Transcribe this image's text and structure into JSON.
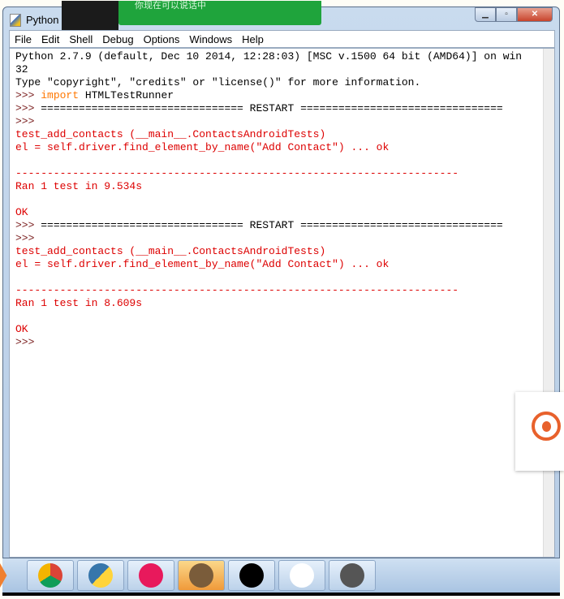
{
  "window": {
    "title": "Python",
    "overlay_text": "你现在可以说话中"
  },
  "menu": [
    "File",
    "Edit",
    "Shell",
    "Debug",
    "Options",
    "Windows",
    "Help"
  ],
  "lines": [
    [
      {
        "t": "Python 2.7.9 (default, Dec 10 2014, 12:28:03) [MSC v.1500 64 bit (AMD64)] on win",
        "c": "out"
      }
    ],
    [
      {
        "t": "32",
        "c": "out"
      }
    ],
    [
      {
        "t": "Type \"copyright\", \"credits\" or \"license()\" for more information.",
        "c": "out"
      }
    ],
    [
      {
        "t": ">>> ",
        "c": "prompt"
      },
      {
        "t": "import",
        "c": "kw"
      },
      {
        "t": " HTMLTestRunner",
        "c": "out"
      }
    ],
    [
      {
        "t": ">>> ",
        "c": "prompt"
      },
      {
        "t": "================================ RESTART ================================",
        "c": "out"
      }
    ],
    [
      {
        "t": ">>> ",
        "c": "prompt"
      }
    ],
    [
      {
        "t": "test_add_contacts (__main__.ContactsAndroidTests)",
        "c": "err"
      }
    ],
    [
      {
        "t": "el = self.driver.find_element_by_name(\"Add Contact\") ... ok",
        "c": "err"
      }
    ],
    [
      {
        "t": "",
        "c": "err"
      }
    ],
    [
      {
        "t": "----------------------------------------------------------------------",
        "c": "err"
      }
    ],
    [
      {
        "t": "Ran 1 test in 9.534s",
        "c": "err"
      }
    ],
    [
      {
        "t": "",
        "c": "err"
      }
    ],
    [
      {
        "t": "OK",
        "c": "err"
      }
    ],
    [
      {
        "t": ">>> ",
        "c": "prompt"
      },
      {
        "t": "================================ RESTART ================================",
        "c": "out"
      }
    ],
    [
      {
        "t": ">>> ",
        "c": "prompt"
      }
    ],
    [
      {
        "t": "test_add_contacts (__main__.ContactsAndroidTests)",
        "c": "err"
      }
    ],
    [
      {
        "t": "el = self.driver.find_element_by_name(\"Add Contact\") ... ok",
        "c": "err"
      }
    ],
    [
      {
        "t": "",
        "c": "err"
      }
    ],
    [
      {
        "t": "----------------------------------------------------------------------",
        "c": "err"
      }
    ],
    [
      {
        "t": "Ran 1 test in 8.609s",
        "c": "err"
      }
    ],
    [
      {
        "t": "",
        "c": "err"
      }
    ],
    [
      {
        "t": "OK",
        "c": "err"
      }
    ],
    [
      {
        "t": ">>> ",
        "c": "prompt"
      }
    ]
  ],
  "taskbar": [
    {
      "name": "chrome-icon",
      "bg": "conic-gradient(#db4437 0 33%,#0f9d58 0 66%,#f4b400 0)",
      "active": false
    },
    {
      "name": "python-file-icon",
      "bg": "linear-gradient(135deg,#3776ab 50%,#ffd43b 50%)",
      "active": false
    },
    {
      "name": "flickr-app-icon",
      "bg": "#e8195c",
      "active": false
    },
    {
      "name": "contacts-app-icon",
      "bg": "#7a5c3a",
      "active": true
    },
    {
      "name": "terminal-icon",
      "bg": "#000",
      "active": false
    },
    {
      "name": "flickr-app-icon-2",
      "bg": "#fff",
      "active": false
    },
    {
      "name": "sublime-text-icon",
      "bg": "#555",
      "active": false
    }
  ]
}
